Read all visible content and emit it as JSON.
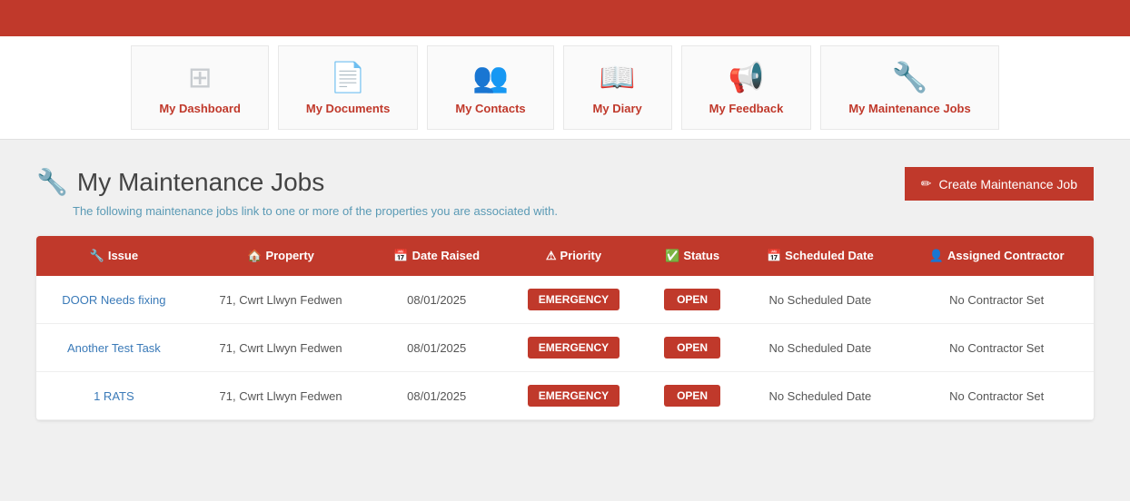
{
  "topbar": {},
  "nav": {
    "items": [
      {
        "id": "dashboard",
        "label": "My Dashboard",
        "icon": "⊞"
      },
      {
        "id": "documents",
        "label": "My Documents",
        "icon": "📄"
      },
      {
        "id": "contacts",
        "label": "My Contacts",
        "icon": "👥"
      },
      {
        "id": "diary",
        "label": "My Diary",
        "icon": "📖"
      },
      {
        "id": "feedback",
        "label": "My Feedback",
        "icon": "📢"
      },
      {
        "id": "maintenance",
        "label": "My Maintenance Jobs",
        "icon": "🔧"
      }
    ]
  },
  "page": {
    "title": "My Maintenance Jobs",
    "subtitle": "The following maintenance jobs link to one or more of the properties you are associated with.",
    "create_button": "Create Maintenance Job"
  },
  "table": {
    "columns": [
      {
        "id": "issue",
        "label": "Issue",
        "icon": "🔧"
      },
      {
        "id": "property",
        "label": "Property",
        "icon": "🏠"
      },
      {
        "id": "date_raised",
        "label": "Date Raised",
        "icon": "📅"
      },
      {
        "id": "priority",
        "label": "Priority",
        "icon": "⚠"
      },
      {
        "id": "status",
        "label": "Status",
        "icon": "✅"
      },
      {
        "id": "scheduled_date",
        "label": "Scheduled Date",
        "icon": "📅"
      },
      {
        "id": "assigned_contractor",
        "label": "Assigned Contractor",
        "icon": "👤"
      }
    ],
    "rows": [
      {
        "issue": "DOOR Needs fixing",
        "property": "71, Cwrt Llwyn Fedwen",
        "date_raised": "08/01/2025",
        "priority": "EMERGENCY",
        "status": "OPEN",
        "scheduled_date": "No Scheduled Date",
        "assigned_contractor": "No Contractor Set"
      },
      {
        "issue": "Another Test Task",
        "property": "71, Cwrt Llwyn Fedwen",
        "date_raised": "08/01/2025",
        "priority": "EMERGENCY",
        "status": "OPEN",
        "scheduled_date": "No Scheduled Date",
        "assigned_contractor": "No Contractor Set"
      },
      {
        "issue": "1 RATS",
        "property": "71, Cwrt Llwyn Fedwen",
        "date_raised": "08/01/2025",
        "priority": "EMERGENCY",
        "status": "OPEN",
        "scheduled_date": "No Scheduled Date",
        "assigned_contractor": "No Contractor Set"
      }
    ]
  }
}
